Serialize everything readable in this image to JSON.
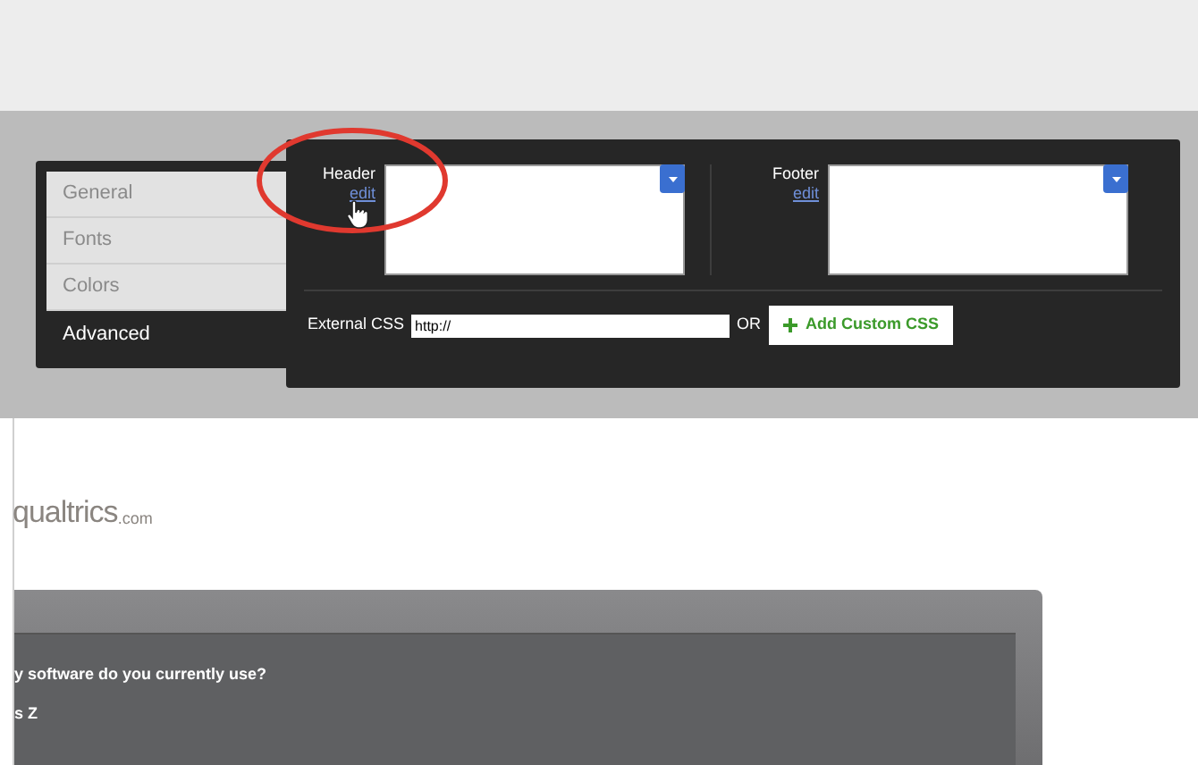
{
  "tabs": [
    {
      "label": "General",
      "selected": false
    },
    {
      "label": "Fonts",
      "selected": false
    },
    {
      "label": "Colors",
      "selected": false
    },
    {
      "label": "Advanced",
      "selected": true
    }
  ],
  "editors": [
    {
      "label": "Header",
      "link": "edit"
    },
    {
      "label": "Footer",
      "link": "edit"
    }
  ],
  "annotation": {
    "kind": "circle",
    "cursor": true
  },
  "external_css": {
    "label": "External CSS",
    "value": "http://",
    "or": "OR",
    "button": "Add Custom CSS"
  },
  "logo": {
    "name": "qualtrics",
    "suffix": ".com"
  },
  "survey": {
    "question": "y software do you currently use?",
    "choices": [
      "s Z"
    ]
  }
}
